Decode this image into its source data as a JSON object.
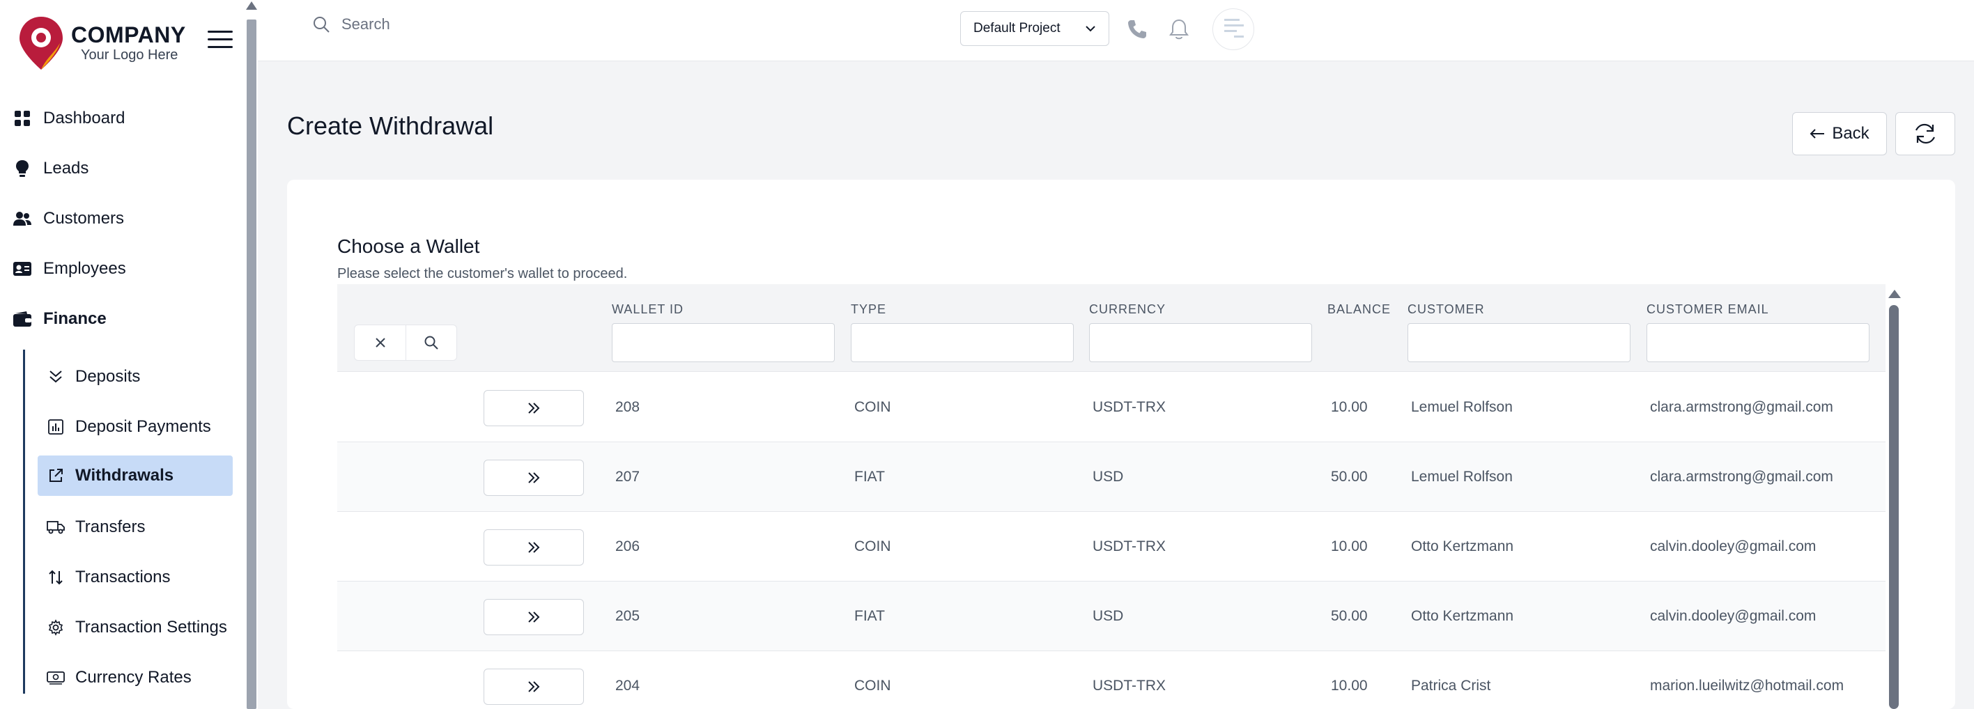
{
  "brand": {
    "title": "COMPANY",
    "subtitle": "Your Logo Here",
    "colors": {
      "primary": "#b91c3c",
      "accent": "#f59e0b"
    }
  },
  "nav": {
    "items": [
      {
        "label": "Dashboard",
        "icon": "grid-icon"
      },
      {
        "label": "Leads",
        "icon": "lightbulb-icon"
      },
      {
        "label": "Customers",
        "icon": "users-icon"
      },
      {
        "label": "Employees",
        "icon": "id-card-icon"
      },
      {
        "label": "Finance",
        "icon": "wallet-icon"
      }
    ],
    "finance_sub": [
      {
        "label": "Deposits",
        "icon": "double-chevron-down-icon"
      },
      {
        "label": "Deposit Payments",
        "icon": "bar-chart-icon"
      },
      {
        "label": "Withdrawals",
        "icon": "external-link-icon",
        "active": true
      },
      {
        "label": "Transfers",
        "icon": "truck-icon"
      },
      {
        "label": "Transactions",
        "icon": "arrows-up-down-icon"
      },
      {
        "label": "Transaction Settings",
        "icon": "gear-icon"
      },
      {
        "label": "Currency Rates",
        "icon": "banknote-icon"
      }
    ]
  },
  "topbar": {
    "search_placeholder": "Search",
    "project": "Default Project"
  },
  "page": {
    "title": "Create Withdrawal",
    "back_label": "Back"
  },
  "card": {
    "title": "Choose a Wallet",
    "subtitle": "Please select the customer's wallet to proceed."
  },
  "table": {
    "columns": [
      "WALLET ID",
      "TYPE",
      "CURRENCY",
      "BALANCE",
      "CUSTOMER",
      "CUSTOMER EMAIL"
    ],
    "rows": [
      {
        "wallet_id": "208",
        "type": "COIN",
        "currency": "USDT-TRX",
        "balance": "10.00",
        "customer": "Lemuel Rolfson",
        "email": "clara.armstrong@gmail.com"
      },
      {
        "wallet_id": "207",
        "type": "FIAT",
        "currency": "USD",
        "balance": "50.00",
        "customer": "Lemuel Rolfson",
        "email": "clara.armstrong@gmail.com"
      },
      {
        "wallet_id": "206",
        "type": "COIN",
        "currency": "USDT-TRX",
        "balance": "10.00",
        "customer": "Otto Kertzmann",
        "email": "calvin.dooley@gmail.com"
      },
      {
        "wallet_id": "205",
        "type": "FIAT",
        "currency": "USD",
        "balance": "50.00",
        "customer": "Otto Kertzmann",
        "email": "calvin.dooley@gmail.com"
      },
      {
        "wallet_id": "204",
        "type": "COIN",
        "currency": "USDT-TRX",
        "balance": "10.00",
        "customer": "Patrica Crist",
        "email": "marion.lueilwitz@hotmail.com"
      }
    ]
  }
}
